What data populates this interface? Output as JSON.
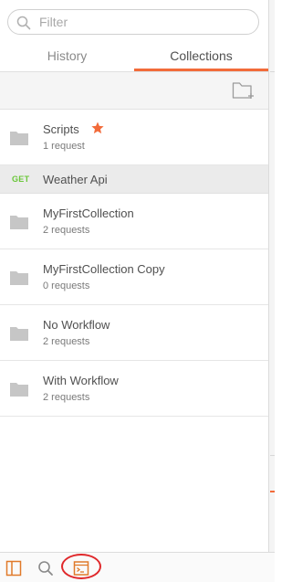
{
  "search": {
    "placeholder": "Filter",
    "value": ""
  },
  "tabs": [
    {
      "label": "History",
      "active": false
    },
    {
      "label": "Collections",
      "active": true
    }
  ],
  "toolbar": {
    "icon": "new-collection-folder-icon"
  },
  "collections": [
    {
      "name": "Scripts",
      "count": "1 request",
      "starred": true
    },
    {
      "name": "MyFirstCollection",
      "count": "2 requests",
      "starred": false
    },
    {
      "name": "MyFirstCollection Copy",
      "count": "0 requests",
      "starred": false
    },
    {
      "name": "No Workflow",
      "count": "2 requests",
      "starred": false
    },
    {
      "name": "With Workflow",
      "count": "2 requests",
      "starred": false
    }
  ],
  "expanded_request": {
    "method": "GET",
    "name": "Weather Api"
  },
  "bottom_bar": {
    "icons": [
      "sidebar-toggle-icon",
      "search-icon",
      "console-icon"
    ],
    "highlighted": "console-icon"
  },
  "colors": {
    "accent": "#f26b3a",
    "get_method": "#6bc73a",
    "highlight_circle": "#e0282b"
  }
}
